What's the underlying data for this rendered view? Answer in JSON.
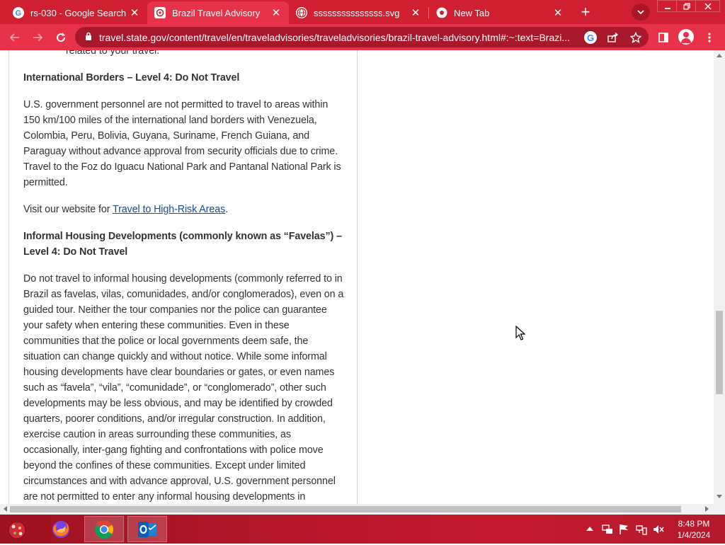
{
  "browser": {
    "tabs": [
      {
        "title": "rs-030 - Google Search",
        "active": false,
        "icon": "google-icon"
      },
      {
        "title": "Brazil Travel Advisory",
        "active": true,
        "icon": "state-dept-icon"
      },
      {
        "title": "sssssssssssssss.svg",
        "active": false,
        "icon": "globe-icon"
      },
      {
        "title": "New Tab",
        "active": false,
        "icon": "chrome-icon"
      }
    ],
    "new_tab_symbol": "+",
    "close_symbol": "✕",
    "url": "travel.state.gov/content/travel/en/traveladvisories/traveladvisories/brazil-travel-advisory.html#:~:text=Brazi..."
  },
  "article": {
    "top_fragment": "related to your travel.",
    "borders_heading": "International Borders – Level 4: Do Not Travel",
    "borders_paragraph": "U.S. government personnel are not permitted to travel to areas within 150 km/100 miles of the international land borders with Venezuela, Colombia, Peru, Bolivia, Guyana, Suriname, French Guiana, and Paraguay without advance approval from security officials due to crime. Travel to the Foz do Iguacu National Park and Pantanal National Park is permitted.",
    "visit_prefix": "Visit our website for ",
    "visit_link": "Travel to High-Risk Areas",
    "visit_suffix": ".",
    "favelas_heading": "Informal Housing Developments (commonly known as “Favelas”) – Level 4: Do Not Travel",
    "favelas_paragraph": "Do not travel to informal housing developments (commonly referred to in Brazil as favelas, vilas, comunidades, and/or conglomerados), even on a guided tour.  Neither the tour companies nor the police can guarantee your safety when entering these communities.  Even in these communities that the police or local governments deem safe, the situation can change quickly and without notice.  While some informal housing developments have clear boundaries or gates, or even names such as “favela”, “vila”, “comunidade”, or “conglomerado”, other such developments may be less obvious, and may be identified by crowded quarters, poorer conditions, and/or irregular construction.  In addition, exercise caution in areas surrounding these communities, as occasionally, inter-gang fighting and confrontations with police move beyond the confines of these communities.  Except under limited circumstances and with advance approval, U.S. government personnel are not permitted to enter any informal housing developments in"
  },
  "taskbar": {
    "apps": [
      "firefox-icon",
      "chrome-icon",
      "outlook-icon"
    ],
    "time": "8:48 PM",
    "date": "1/4/2024"
  },
  "colors": {
    "tab_strip": "#cf1f30",
    "toolbar": "#e8324a",
    "link": "#1a4b8a"
  }
}
